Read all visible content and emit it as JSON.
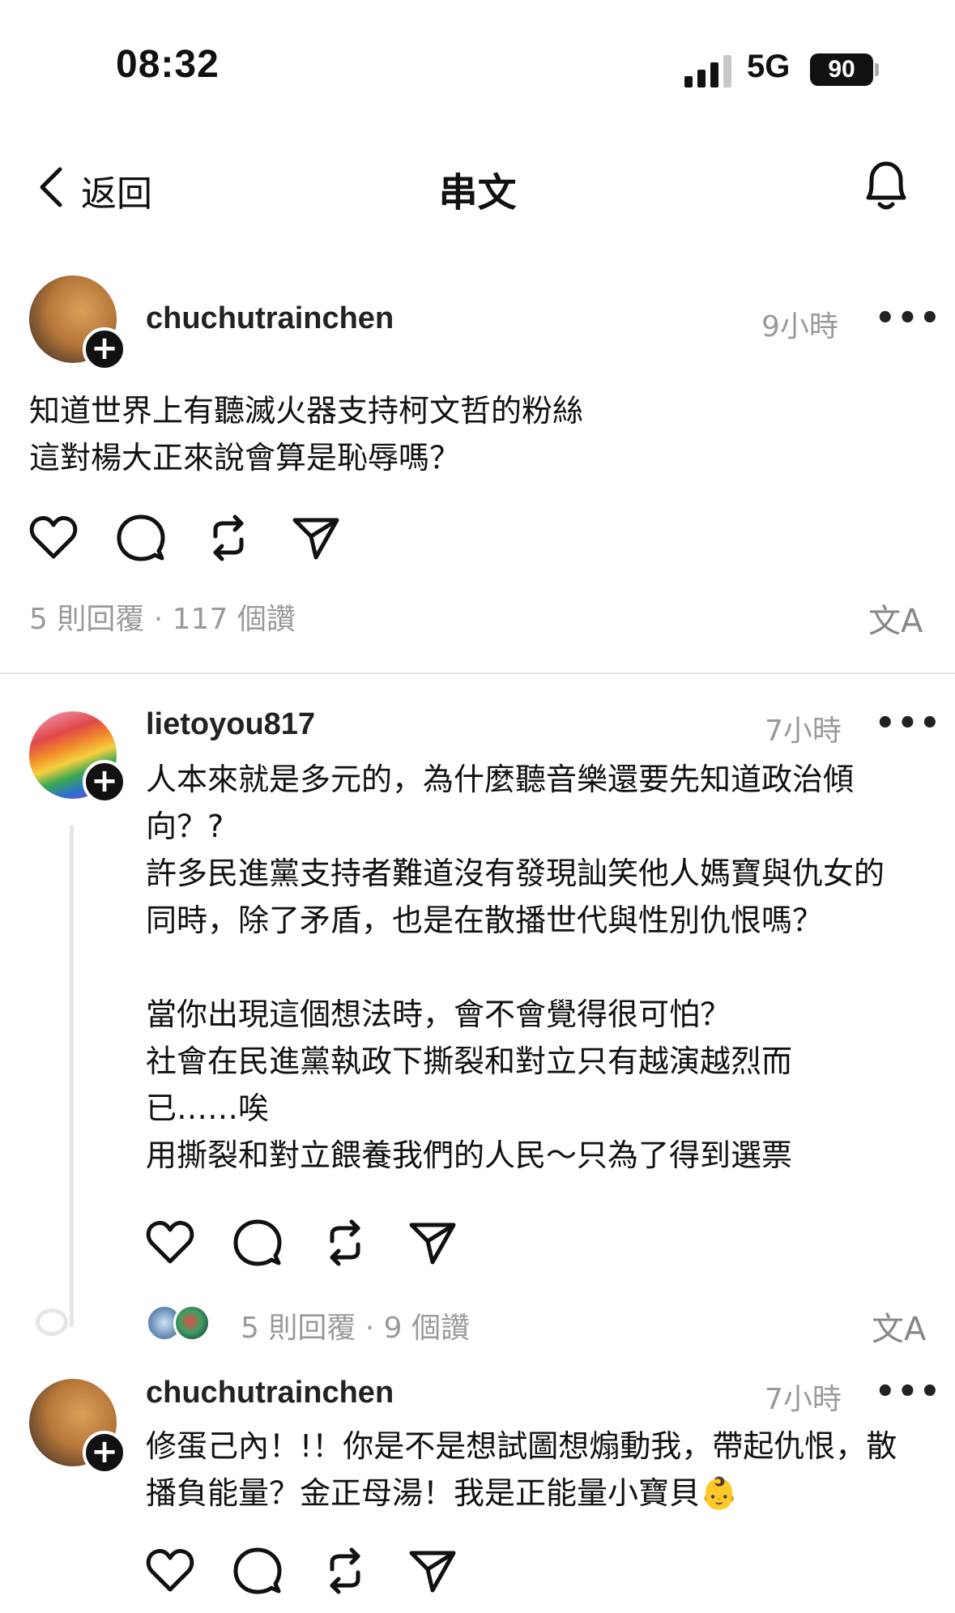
{
  "status_bar": {
    "time": "08:32",
    "network": "5G",
    "battery": "90"
  },
  "header": {
    "back_label": "返回",
    "title": "串文"
  },
  "post": {
    "username": "chuchutrainchen",
    "time": "9小時",
    "text": "知道世界上有聽滅火器支持柯文哲的粉絲\n這對楊大正來說會算是恥辱嗎？",
    "stats": "5 則回覆 · 117 個讚"
  },
  "reply1": {
    "username": "lietoyou817",
    "time": "7小時",
    "text": "人本來就是多元的，為什麼聽音樂還要先知道政治傾\n向？?\n許多民進黨支持者難道沒有發現訕笑他人媽寶與仇女的\n同時，除了矛盾，也是在散播世代與性別仇恨嗎？\n\n當你出現這個想法時，會不會覺得很可怕？\n社會在民進黨執政下撕裂和對立只有越演越烈而\n已……唉\n用撕裂和對立餵養我們的人民～只為了得到選票",
    "stats": "5 則回覆 · 9 個讚"
  },
  "reply2": {
    "username": "chuchutrainchen",
    "time": "7小時",
    "text": "修蛋己內！!！你是不是想試圖想煽動我，帶起仇恨，散\n播負能量？金正母湯！我是正能量小寶貝👶"
  },
  "icons": {
    "more": "•••",
    "translate": "文A",
    "follow": "+"
  },
  "colors": {
    "muted": "#9a9a9a",
    "text": "#111111"
  }
}
